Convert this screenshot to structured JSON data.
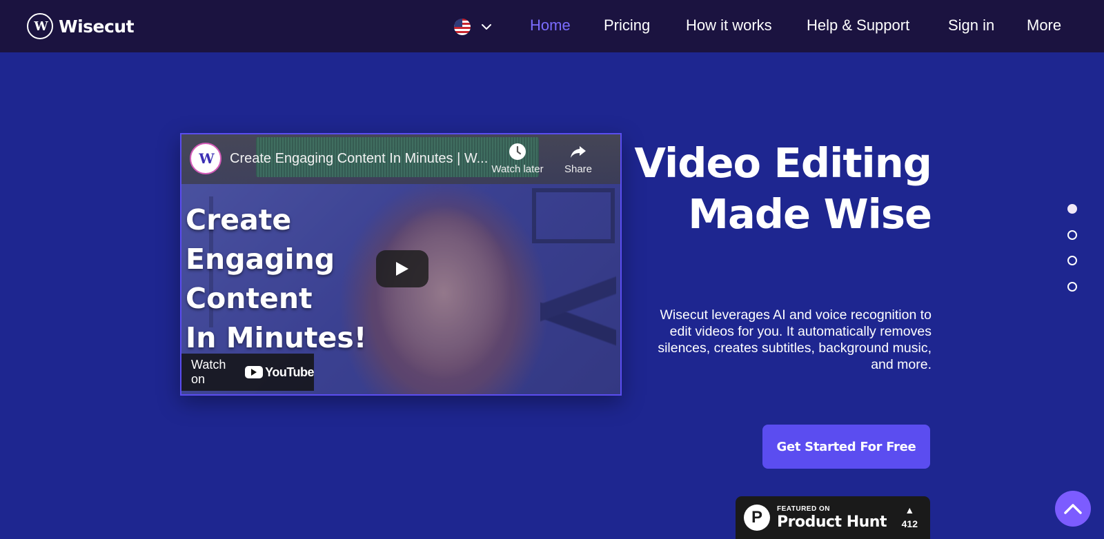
{
  "header": {
    "logo_text": "Wisecut",
    "logo_mark": "W",
    "language_icon": "us-flag-icon",
    "nav": [
      {
        "label": "Home",
        "active": true
      },
      {
        "label": "Pricing",
        "active": false
      },
      {
        "label": "How it works",
        "active": false
      },
      {
        "label": "Help & Support",
        "active": false
      },
      {
        "label": "Sign in",
        "active": false
      },
      {
        "label": "More",
        "active": false
      }
    ]
  },
  "video": {
    "channel_mark": "W",
    "title": "Create Engaging Content In Minutes | W...",
    "watch_later_label": "Watch later",
    "share_label": "Share",
    "headline_lines": [
      "Create",
      "Engaging",
      "Content",
      "In Minutes!"
    ],
    "watch_on_label": "Watch on",
    "youtube_label": "YouTube"
  },
  "hero": {
    "title_line1": "Video Editing",
    "title_line2": "Made Wise",
    "description": "Wisecut leverages AI and voice recognition to edit videos for you. It automatically removes silences, creates subtitles, background music, and more.",
    "cta_label": "Get Started For Free"
  },
  "product_hunt": {
    "letter": "P",
    "featured_label": "FEATURED ON",
    "name": "Product Hunt",
    "arrow": "▲",
    "votes": "412"
  },
  "pagination": {
    "count": 4,
    "active_index": 0
  },
  "colors": {
    "background": "#1e2690",
    "header": "#1b1340",
    "accent": "#5b4df0",
    "nav_active": "#7b6cff",
    "scroll_top": "#7c5cff"
  }
}
